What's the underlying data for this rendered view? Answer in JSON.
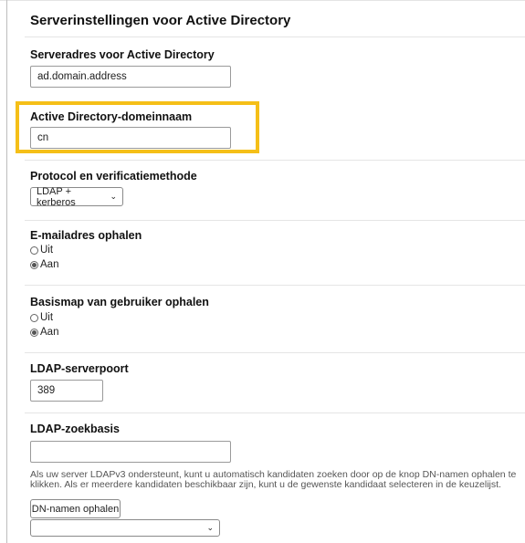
{
  "section_title": "Serverinstellingen voor Active Directory",
  "server_address": {
    "label": "Serveradres voor Active Directory",
    "value": "ad.domain.address"
  },
  "domain_name": {
    "label": "Active Directory-domeinnaam",
    "value": "cn"
  },
  "protocol": {
    "label": "Protocol en verificatiemethode",
    "selected": "LDAP + kerberos"
  },
  "email_fetch": {
    "label": "E-mailadres ophalen",
    "options": [
      "Uit",
      "Aan"
    ],
    "selected": "Aan"
  },
  "home_folder": {
    "label": "Basismap van gebruiker ophalen",
    "options": [
      "Uit",
      "Aan"
    ],
    "selected": "Aan"
  },
  "ldap_port": {
    "label": "LDAP-serverpoort",
    "value": "389"
  },
  "ldap_search_base": {
    "label": "LDAP-zoekbasis",
    "value": "",
    "help": "Als uw server LDAPv3 ondersteunt, kunt u automatisch kandidaten zoeken door op de knop DN-namen ophalen te klikken. Als er meerdere kandidaten beschikbaar zijn, kunt u de gewenste kandidaat selecteren in de keuzelijst.",
    "fetch_button": "DN-namen ophalen",
    "candidate_selected": ""
  },
  "colors": {
    "highlight": "#f5bf18"
  }
}
